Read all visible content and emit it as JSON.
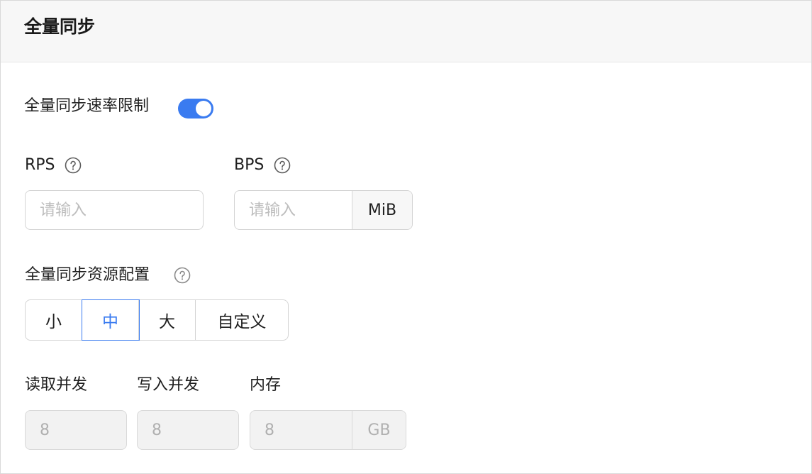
{
  "header": {
    "title": "全量同步"
  },
  "rate_limit": {
    "label": "全量同步速率限制",
    "enabled": true
  },
  "rps": {
    "label": "RPS",
    "placeholder": "请输入"
  },
  "bps": {
    "label": "BPS",
    "placeholder": "请输入",
    "unit": "MiB"
  },
  "resource": {
    "label": "全量同步资源配置",
    "options": [
      "小",
      "中",
      "大",
      "自定义"
    ],
    "selected": "中"
  },
  "read_concurrency": {
    "label": "读取并发",
    "value": "8"
  },
  "write_concurrency": {
    "label": "写入并发",
    "value": "8"
  },
  "memory": {
    "label": "内存",
    "value": "8",
    "unit": "GB"
  },
  "colors": {
    "accent": "#3a7bf0"
  },
  "icons": {
    "help": "help-icon"
  }
}
